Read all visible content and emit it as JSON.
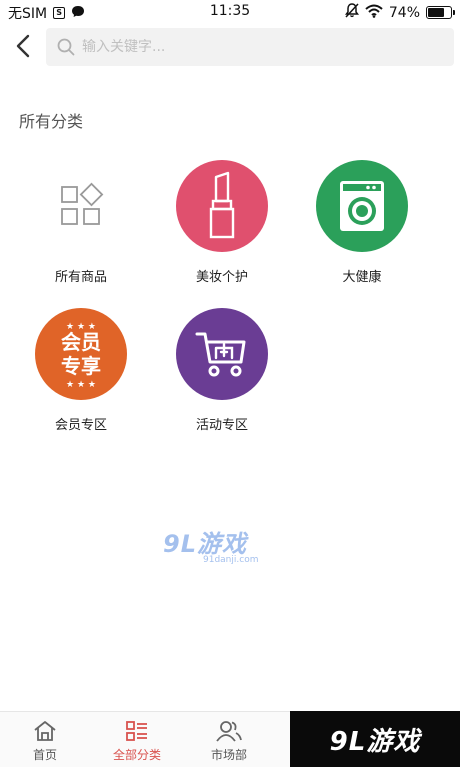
{
  "status_bar": {
    "carrier": "无SIM",
    "sim_indicator": "S",
    "time": "11:35",
    "battery_percent": "74%",
    "battery_level": 0.74,
    "icons": [
      "message-icon",
      "mute-icon",
      "wifi-icon",
      "battery-icon"
    ]
  },
  "header": {
    "back_icon": "chevron-left-icon",
    "search_placeholder": "输入关键字..."
  },
  "section": {
    "title": "所有分类"
  },
  "categories": [
    {
      "label": "所有商品",
      "icon": "grid-icon",
      "color": "#ffffff"
    },
    {
      "label": "美妆个护",
      "icon": "lipstick-icon",
      "color": "#e0506e"
    },
    {
      "label": "大健康",
      "icon": "washing-machine-icon",
      "color": "#2ba05a"
    },
    {
      "label": "会员专区",
      "icon": "member-badge-icon",
      "color": "#e06428",
      "badge_text_1": "会员",
      "badge_text_2": "专享"
    },
    {
      "label": "活动专区",
      "icon": "shopping-cart-icon",
      "color": "#6a3d94"
    }
  ],
  "watermark": {
    "center_main": "9L游戏",
    "center_sub": "91danji.com",
    "corner": "9L游戏"
  },
  "bottom_nav": [
    {
      "label": "首页",
      "icon": "home-icon",
      "active": false
    },
    {
      "label": "全部分类",
      "icon": "category-list-icon",
      "active": true
    },
    {
      "label": "市场部",
      "icon": "people-icon",
      "active": false
    }
  ],
  "colors": {
    "accent": "#d9534f",
    "search_bg": "#f2f2f2"
  }
}
